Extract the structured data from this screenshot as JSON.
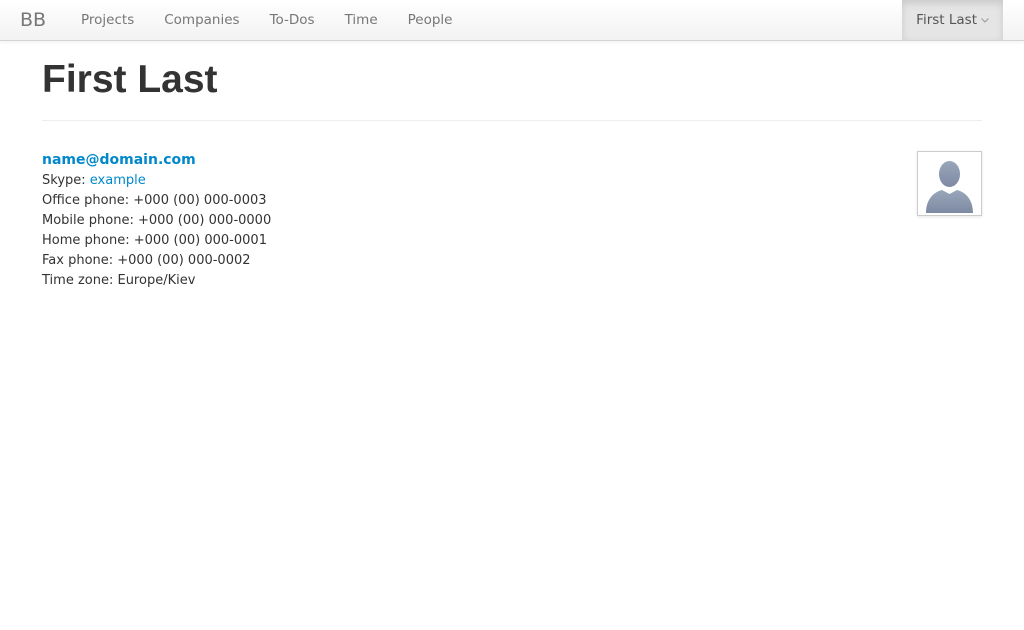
{
  "navbar": {
    "brand": "BB",
    "items": [
      {
        "label": "Projects"
      },
      {
        "label": "Companies"
      },
      {
        "label": "To-Dos"
      },
      {
        "label": "Time"
      },
      {
        "label": "People"
      }
    ],
    "user_menu": {
      "label": "First Last",
      "icon": "chevron-down-icon"
    }
  },
  "page": {
    "title": "First Last"
  },
  "profile": {
    "email": "name@domain.com",
    "skype_label": "Skype: ",
    "skype_value": "example",
    "office_phone": "Office phone: +000 (00) 000-0003",
    "mobile_phone": "Mobile phone: +000 (00) 000-0000",
    "home_phone": "Home phone: +000 (00) 000-0001",
    "fax_phone": "Fax phone: +000 (00) 000-0002",
    "time_zone": "Time zone: Europe/Kiev",
    "avatar_icon": "user-silhouette-icon"
  },
  "colors": {
    "link": "#0088cc",
    "heading": "#333333",
    "nav_text": "#777777"
  }
}
